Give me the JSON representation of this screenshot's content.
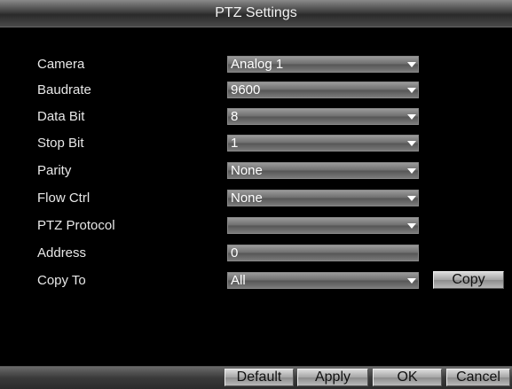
{
  "window": {
    "title": "PTZ Settings"
  },
  "form": {
    "camera": {
      "label": "Camera",
      "value": "Analog 1"
    },
    "baudrate": {
      "label": "Baudrate",
      "value": "9600"
    },
    "data_bit": {
      "label": "Data Bit",
      "value": "8"
    },
    "stop_bit": {
      "label": "Stop Bit",
      "value": "1"
    },
    "parity": {
      "label": "Parity",
      "value": "None"
    },
    "flow_ctrl": {
      "label": "Flow Ctrl",
      "value": "None"
    },
    "ptz_protocol": {
      "label": "PTZ Protocol",
      "value": ""
    },
    "address": {
      "label": "Address",
      "value": "0"
    },
    "copy_to": {
      "label": "Copy To",
      "value": "All",
      "button": "Copy"
    }
  },
  "footer": {
    "default_label": "Default",
    "apply_label": "Apply",
    "ok_label": "OK",
    "cancel_label": "Cancel"
  },
  "icons": {
    "dropdown": "chevron-down-icon"
  }
}
